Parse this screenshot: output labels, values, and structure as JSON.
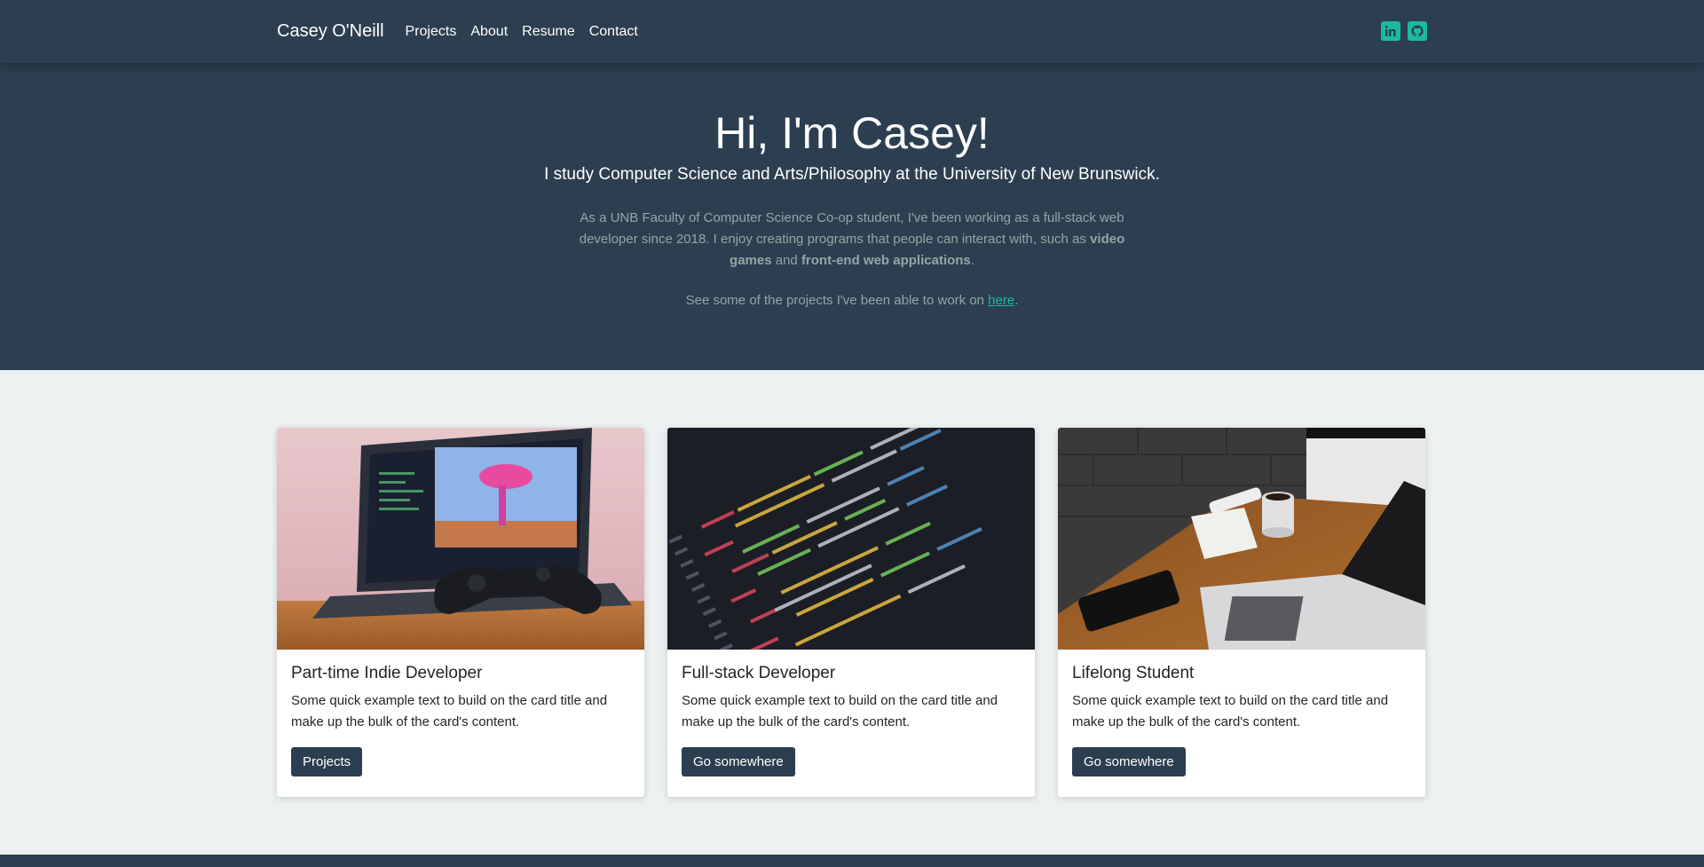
{
  "nav": {
    "brand": "Casey O'Neill",
    "links": [
      "Projects",
      "About",
      "Resume",
      "Contact"
    ],
    "social": [
      "linkedin-icon",
      "github-icon"
    ]
  },
  "hero": {
    "title": "Hi, I'm Casey!",
    "lead": "I study Computer Science and Arts/Philosophy at the University of New Brunswick.",
    "blurb_1": "As a UNB Faculty of Computer Science Co-op student, I've been working as a full-stack web developer since 2018. I enjoy creating programs that people can interact with, such as ",
    "blurb_bold_1": "video games",
    "blurb_2": " and ",
    "blurb_bold_2": "front-end web applications",
    "blurb_3": ".",
    "see_text": "See some of the projects I've been able to work on ",
    "see_link": "here",
    "see_end": "."
  },
  "cards": [
    {
      "title": "Part-time Indie Developer",
      "text": "Some quick example text to build on the card title and make up the bulk of the card's content.",
      "button": "Projects"
    },
    {
      "title": "Full-stack Developer",
      "text": "Some quick example text to build on the card title and make up the bulk of the card's content.",
      "button": "Go somewhere"
    },
    {
      "title": "Lifelong Student",
      "text": "Some quick example text to build on the card title and make up the bulk of the card's content.",
      "button": "Go somewhere"
    }
  ],
  "colors": {
    "primary": "#2c3e50",
    "accent": "#18bc9c",
    "muted": "#95a5a6",
    "background": "#ecf0f1"
  }
}
